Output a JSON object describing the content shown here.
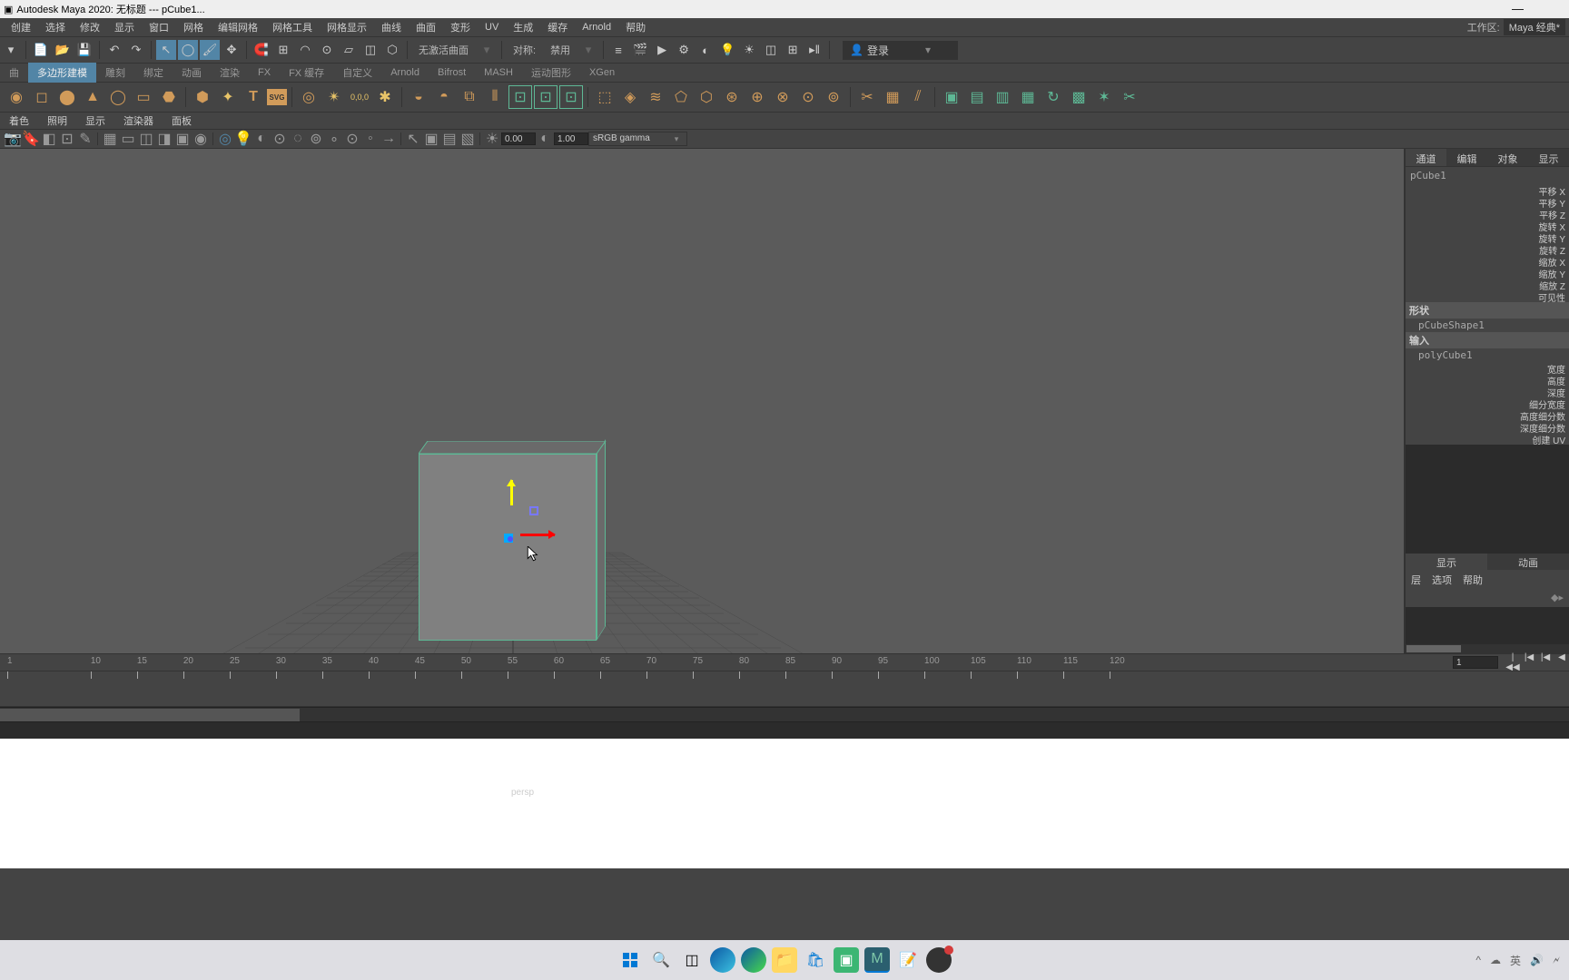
{
  "title": "Autodesk Maya 2020: 无标题  ---  pCube1...",
  "window_controls": {
    "minimize": "—"
  },
  "menubar": {
    "items": [
      "创建",
      "选择",
      "修改",
      "显示",
      "窗口",
      "网格",
      "编辑网格",
      "网格工具",
      "网格显示",
      "曲线",
      "曲面",
      "变形",
      "UV",
      "生成",
      "缓存",
      "Arnold",
      "帮助"
    ],
    "workspace_label": "工作区:",
    "workspace_value": "Maya 经典*"
  },
  "toolbar": {
    "no_active_surface": "无激活曲面",
    "symmetry_label": "对称:",
    "symmetry_value": "禁用",
    "login": "登录"
  },
  "shelf": {
    "first": "曲",
    "tabs": [
      "多边形建模",
      "雕刻",
      "绑定",
      "动画",
      "渲染",
      "FX",
      "FX 缓存",
      "自定义",
      "Arnold",
      "Bifrost",
      "MASH",
      "运动图形",
      "XGen"
    ]
  },
  "panel": {
    "tabs": [
      "着色",
      "照明",
      "显示",
      "渲染器",
      "面板"
    ],
    "value1": "0.00",
    "value2": "1.00",
    "gamma": "sRGB gamma"
  },
  "viewport": {
    "camera": "persp"
  },
  "channel_box": {
    "tabs": [
      "通道",
      "编辑",
      "对象",
      "显示"
    ],
    "object_name": "pCube1",
    "transforms": [
      "平移 X",
      "平移 Y",
      "平移 Z",
      "旋转 X",
      "旋转 Y",
      "旋转 Z",
      "缩放 X",
      "缩放 Y",
      "缩放 Z",
      "可见性"
    ],
    "shape_header": "形状",
    "shape_name": "pCubeShape1",
    "input_header": "输入",
    "input_name": "polyCube1",
    "poly_attrs": [
      "宽度",
      "高度",
      "深度",
      "细分宽度",
      "高度细分数",
      "深度细分数",
      "创建 UV"
    ],
    "bottom_tabs": [
      "显示",
      "动画"
    ],
    "options": [
      "层",
      "选项",
      "帮助"
    ]
  },
  "timeline": {
    "ticks": [
      "1",
      "10",
      "15",
      "20",
      "25",
      "30",
      "35",
      "40",
      "45",
      "50",
      "55",
      "60",
      "65",
      "70",
      "75",
      "80",
      "85",
      "90",
      "95",
      "100",
      "105",
      "110",
      "115",
      "120"
    ],
    "current_frame": "1"
  },
  "taskbar": {
    "tray": [
      "^",
      "●",
      "英",
      "🔊",
      "🗲"
    ],
    "time": ""
  }
}
